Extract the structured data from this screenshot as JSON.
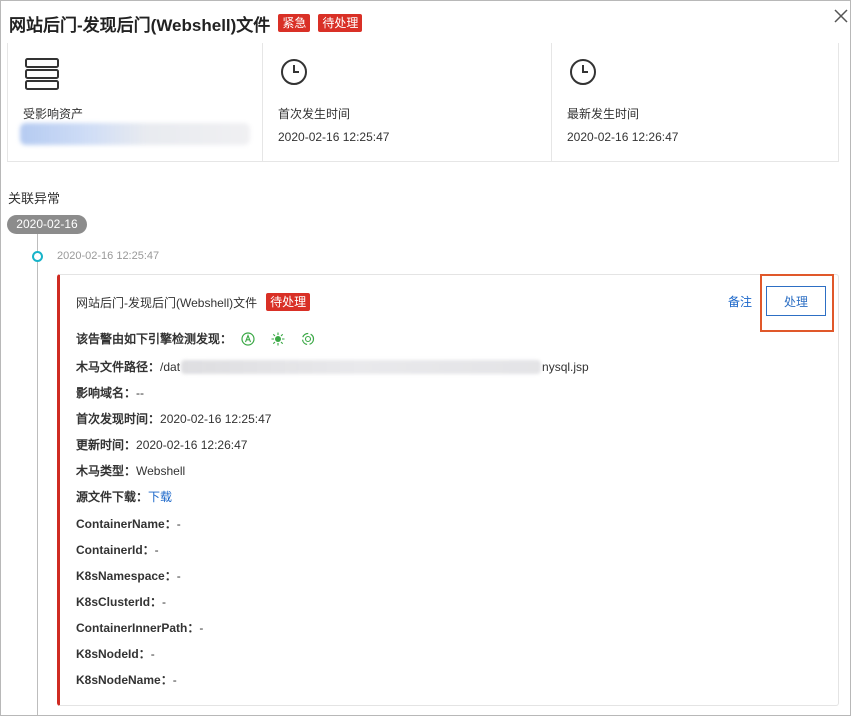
{
  "header": {
    "title": "网站后门-发现后门(Webshell)文件",
    "tags": [
      "紧急",
      "待处理"
    ],
    "close_icon": "close-icon"
  },
  "summary": {
    "asset": {
      "label": "受影响资产",
      "icon": "server-icon"
    },
    "first_time": {
      "label": "首次发生时间",
      "value": "2020-02-16 12:25:47",
      "icon": "clock-icon"
    },
    "last_time": {
      "label": "最新发生时间",
      "value": "2020-02-16 12:26:47",
      "icon": "clock-icon"
    }
  },
  "section_title": "关联异常",
  "timeline": {
    "date": "2020-02-16",
    "time": "2020-02-16 12:25:47"
  },
  "event": {
    "title": "网站后门-发现后门(Webshell)文件",
    "status_tag": "待处理",
    "note_label": "备注",
    "handle_label": "处理",
    "engines_label": "该告警由如下引擎检测发现：",
    "engine_icons": [
      "engine-a-icon",
      "engine-sun-icon",
      "engine-cycle-icon"
    ],
    "path_label": "木马文件路径：",
    "path_prefix": "/dat",
    "path_suffix": "nysql.jsp",
    "domain_label": "影响域名：",
    "domain_value": "--",
    "first_found_label": "首次发现时间：",
    "first_found_value": "2020-02-16 12:25:47",
    "updated_label": "更新时间：",
    "updated_value": "2020-02-16 12:26:47",
    "type_label": "木马类型：",
    "type_value": "Webshell",
    "download_label": "源文件下载：",
    "download_link": "下载",
    "container_name_label": "ContainerName：",
    "container_name_value": "-",
    "container_id_label": "ContainerId：",
    "container_id_value": "-",
    "k8s_namespace_label": "K8sNamespace：",
    "k8s_namespace_value": "-",
    "k8s_cluster_label": "K8sClusterId：",
    "k8s_cluster_value": "-",
    "container_path_label": "ContainerInnerPath：",
    "container_path_value": "-",
    "k8s_node_id_label": "K8sNodeId：",
    "k8s_node_id_value": "-",
    "k8s_node_name_label": "K8sNodeName：",
    "k8s_node_name_value": "-"
  },
  "colors": {
    "danger": "#d93026",
    "link": "#1a66c9",
    "highlight": "#e0582a",
    "timeline_dot": "#17b3c9"
  }
}
